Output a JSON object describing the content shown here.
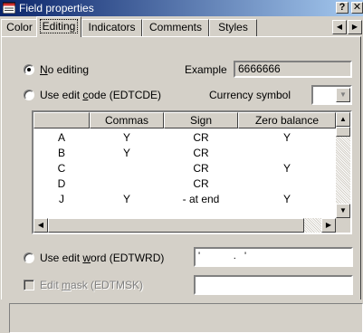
{
  "window": {
    "title": "Field properties",
    "help_button": "?",
    "close_button": "✕"
  },
  "tabs": [
    {
      "label": "Color",
      "active": false
    },
    {
      "label": "Editing",
      "active": true
    },
    {
      "label": "Indicators",
      "active": false
    },
    {
      "label": "Comments",
      "active": false
    },
    {
      "label": "Styles",
      "active": false
    }
  ],
  "options": {
    "no_editing": {
      "label_prefix": "",
      "label_underline": "N",
      "label_rest": "o editing",
      "selected": true
    },
    "example_label": "Example",
    "example_value": "6666666",
    "use_edit_code": {
      "label_prefix": "Use edit ",
      "label_underline": "c",
      "label_rest": "ode (EDTCDE)",
      "selected": false
    },
    "currency_symbol_label": "Currency symbol",
    "currency_symbol_value": "",
    "use_edit_word": {
      "label_prefix": "Use edit ",
      "label_underline": "w",
      "label_rest": "ord (EDTWRD)",
      "selected": false
    },
    "edit_word_value": "'            .   '",
    "edit_mask": {
      "label_prefix": "Edit ",
      "label_underline": "m",
      "label_rest": "ask (EDTMSK)",
      "checked": false,
      "enabled": false
    },
    "edit_mask_value": ""
  },
  "grid": {
    "columns": [
      "",
      "Commas",
      "Sign",
      "Zero balance"
    ],
    "rows": [
      [
        "A",
        "Y",
        "CR",
        "Y"
      ],
      [
        "B",
        "Y",
        "CR",
        ""
      ],
      [
        "C",
        "",
        "CR",
        "Y"
      ],
      [
        "D",
        "",
        "CR",
        ""
      ],
      [
        "J",
        "Y",
        "- at end",
        "Y"
      ]
    ]
  },
  "status_text": ""
}
